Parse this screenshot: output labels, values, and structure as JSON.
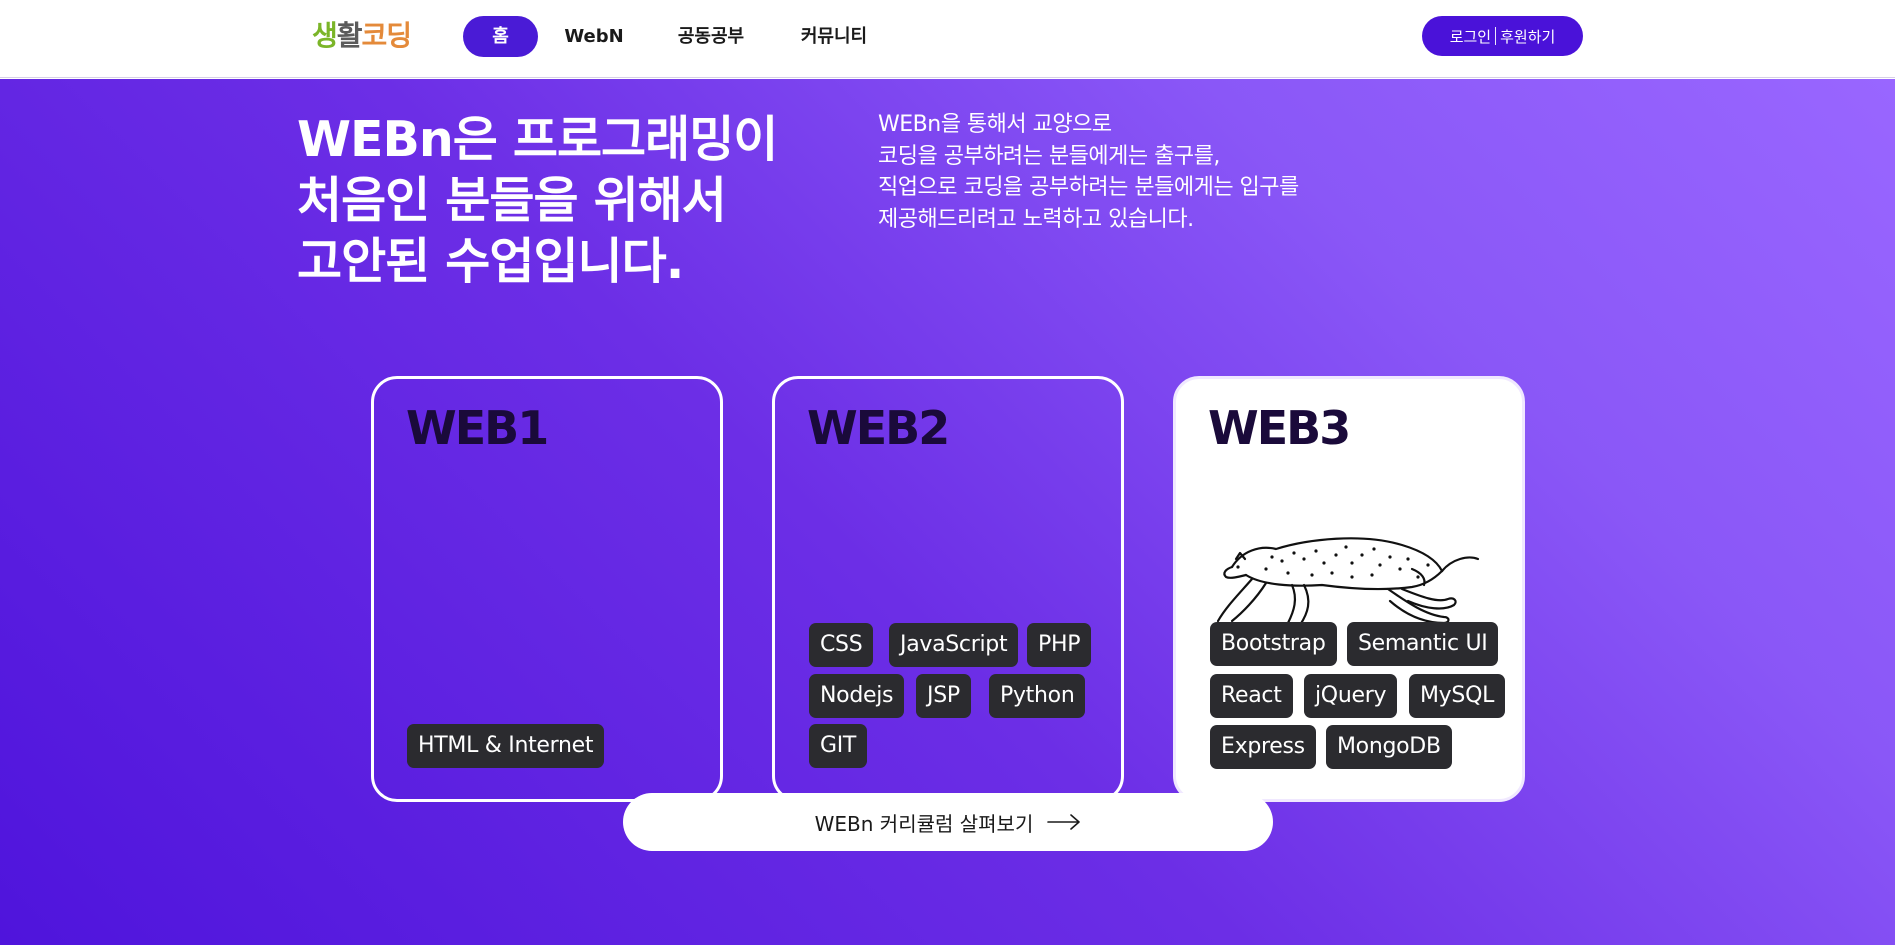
{
  "header": {
    "logo": {
      "part1": "생",
      "part2": "활",
      "part3": "코딩"
    },
    "nav": [
      "홈",
      "WebN",
      "공동공부",
      "커뮤니티"
    ],
    "auth": {
      "login": "로그인",
      "sponsor": "후원하기"
    }
  },
  "hero": {
    "title_lines": [
      "WEBn은 프로그래밍이",
      "처음인 분들을 위해서",
      "고안된 수업입니다."
    ],
    "desc_lines": [
      "WEBn을 통해서 교양으로",
      "코딩을 공부하려는 분들에게는 출구를,",
      "직업으로 코딩을 공부하려는 분들에게는 입구를",
      "제공해드리려고 노력하고 있습니다."
    ]
  },
  "cards": [
    {
      "title": "WEB1",
      "tags": [
        "HTML & Internet"
      ]
    },
    {
      "title": "WEB2",
      "tags": [
        "CSS",
        "JavaScript",
        "PHP",
        "Nodejs",
        "JSP",
        "Python",
        "GIT"
      ]
    },
    {
      "title": "WEB3",
      "tags": [
        "Bootstrap",
        "Semantic UI",
        "React",
        "jQuery",
        "MySQL",
        "Express",
        "MongoDB"
      ],
      "illustration": "cheetah-illustration"
    }
  ],
  "cta": {
    "label": "WEBn 커리큘럼 살펴보기",
    "icon": "arrow-right-icon"
  },
  "colors": {
    "accent": "#4a12d9",
    "tag_bg": "#2b2b2f",
    "gradient_start": "#4f14dc",
    "gradient_end": "#9966ff"
  }
}
